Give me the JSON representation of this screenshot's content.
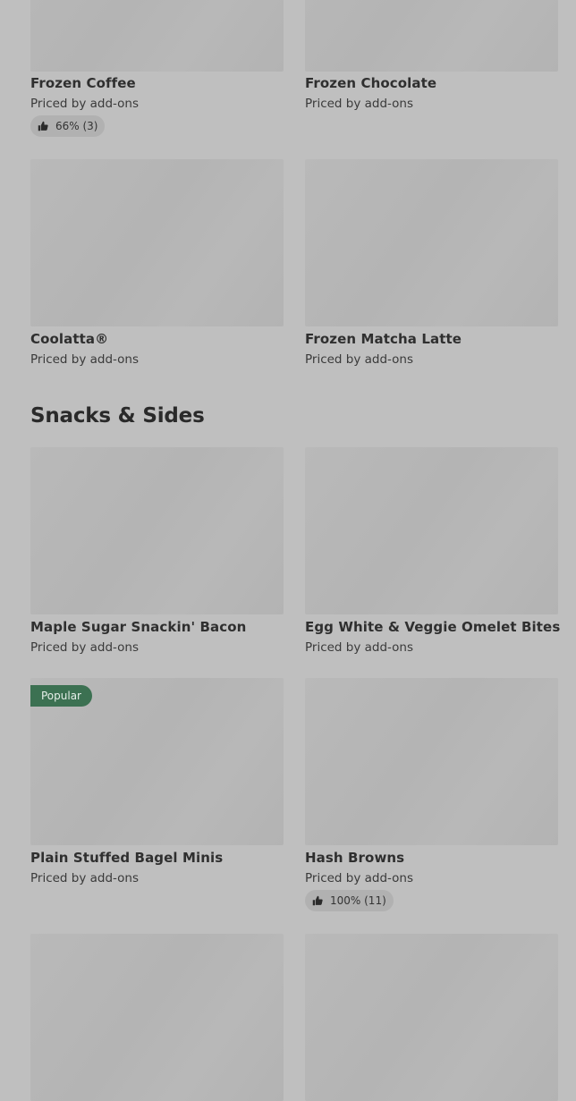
{
  "top_items": [
    {
      "name": "Frozen Coffee",
      "price": "Priced by add-ons",
      "rating": "66% (3)"
    },
    {
      "name": "Frozen Chocolate",
      "price": "Priced by add-ons"
    },
    {
      "name": "Coolatta®",
      "price": "Priced by add-ons"
    },
    {
      "name": "Frozen Matcha Latte",
      "price": "Priced by add-ons"
    }
  ],
  "snacks_section": {
    "title": "Snacks & Sides",
    "items": [
      {
        "name": "Maple Sugar Snackin' Bacon",
        "price": "Priced by add-ons"
      },
      {
        "name": "Egg White & Veggie Omelet Bites",
        "price": "Priced by add-ons"
      },
      {
        "name": "Plain Stuffed Bagel Minis",
        "price": "Priced by add-ons",
        "badge": "Popular"
      },
      {
        "name": "Hash Browns",
        "price": "Priced by add-ons",
        "rating": "100% (11)"
      }
    ]
  },
  "colors": {
    "background": "#bfbfbf",
    "placeholder": "#b6b6b6",
    "badge": "#3c7152",
    "rating_pill": "#b1b1b1"
  },
  "icons": {
    "rating": "thumbs-up-icon"
  }
}
